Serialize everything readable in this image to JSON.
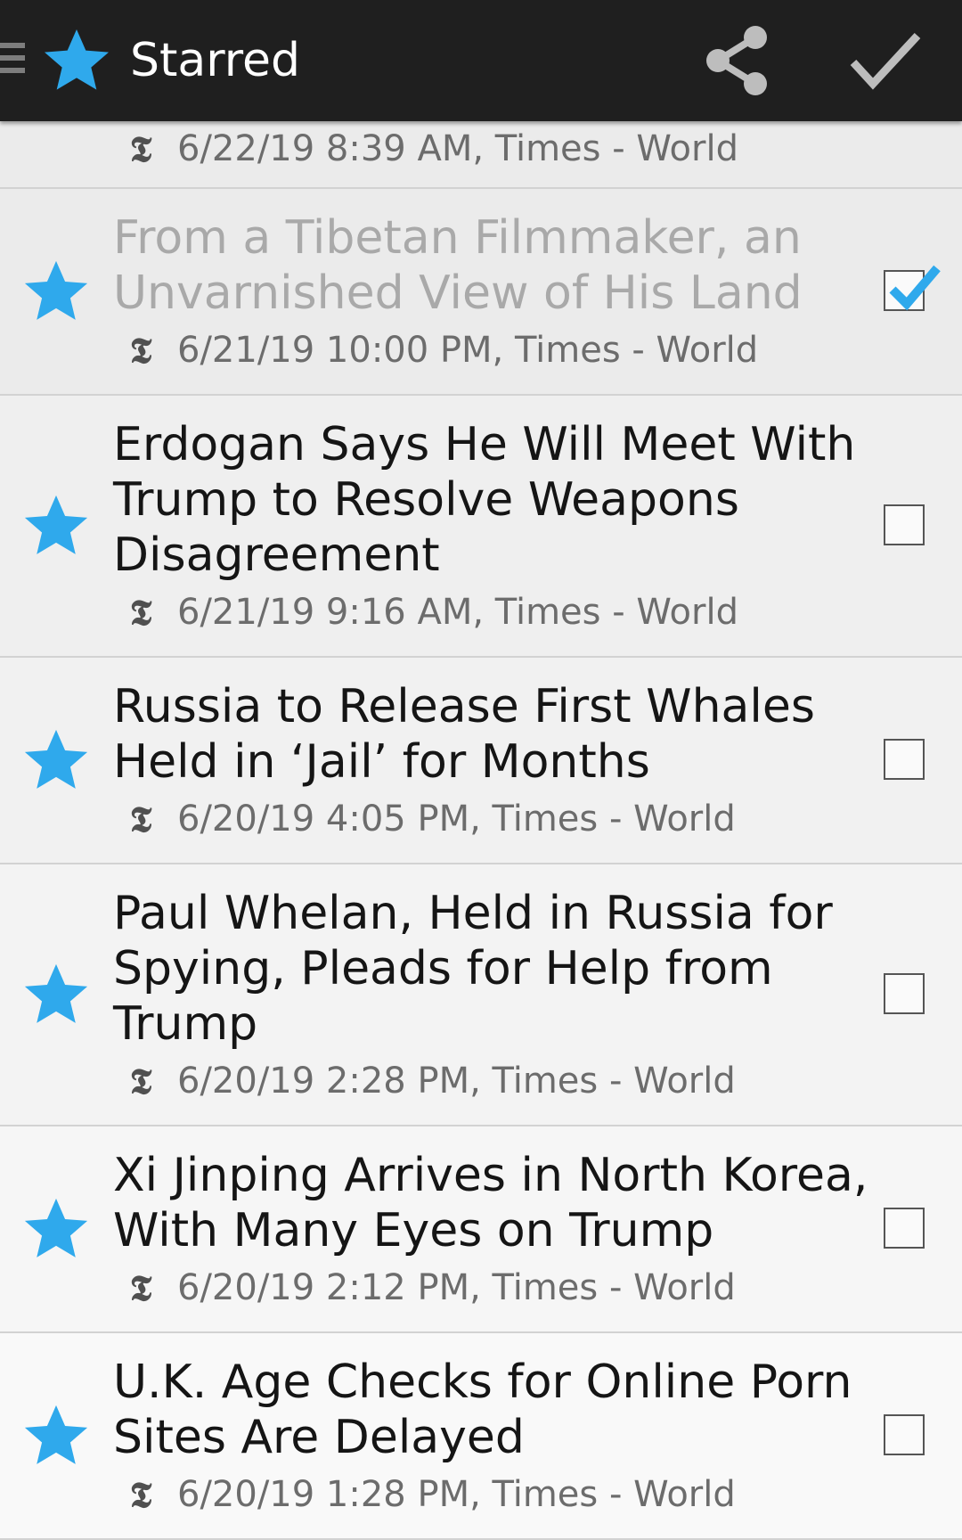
{
  "appbar": {
    "title": "Starred",
    "accent_color": "#2fa9ec",
    "icons": [
      "menu-icon",
      "star-icon",
      "share-icon",
      "check-icon"
    ]
  },
  "rows": [
    {
      "title": "",
      "meta": "6/22/19 8:39 AM, Times - World",
      "starred": false,
      "checked": false,
      "read": true
    },
    {
      "title": "From a Tibetan Filmmaker, an Unvarnished View of His Land",
      "meta": "6/21/19 10:00 PM, Times - World",
      "starred": true,
      "checked": true,
      "read": true
    },
    {
      "title": "Erdogan Says He Will Meet With Trump to Resolve Weapons Disagreement",
      "meta": "6/21/19 9:16 AM, Times - World",
      "starred": true,
      "checked": false,
      "read": false
    },
    {
      "title": "Russia to Release First Whales Held in ‘Jail’ for Months",
      "meta": "6/20/19 4:05 PM, Times - World",
      "starred": true,
      "checked": false,
      "read": false
    },
    {
      "title": "Paul Whelan, Held in Russia for Spying, Pleads for Help from Trump",
      "meta": "6/20/19 2:28 PM, Times - World",
      "starred": true,
      "checked": false,
      "read": false
    },
    {
      "title": "Xi Jinping Arrives in North Korea, With Many Eyes on Trump",
      "meta": "6/20/19 2:12 PM, Times - World",
      "starred": true,
      "checked": false,
      "read": false
    },
    {
      "title": "U.K. Age Checks for Online Porn Sites Are Delayed",
      "meta": "6/20/19 1:28 PM, Times - World",
      "starred": true,
      "checked": false,
      "read": false
    }
  ],
  "source_glyph": "𝕿"
}
